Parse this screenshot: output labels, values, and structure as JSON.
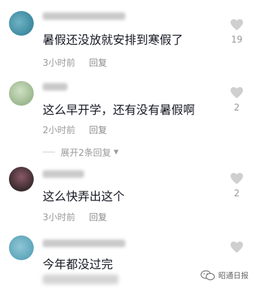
{
  "comments": [
    {
      "text": "暑假还没放就安排到寒假了",
      "time": "3小时前",
      "reply": "回复",
      "likes": "19"
    },
    {
      "text": "这么早开学，还有没有暑假啊",
      "time": "2小时前",
      "reply": "回复",
      "likes": "2"
    },
    {
      "text": "这么快弄出这个",
      "time": "3小时前",
      "reply": "回复",
      "likes": "2"
    },
    {
      "text": "今年都没过完",
      "time": "",
      "reply": "",
      "likes": ""
    }
  ],
  "expand_replies": "展开2条回复",
  "watermark": "昭通日报",
  "colors": {
    "heart": "#cfcfcf",
    "text": "#161823",
    "meta": "#9a9a9a"
  },
  "icons": {
    "like": "heart-icon",
    "expand": "caret-down-icon",
    "watermark": "wechat-icon"
  }
}
